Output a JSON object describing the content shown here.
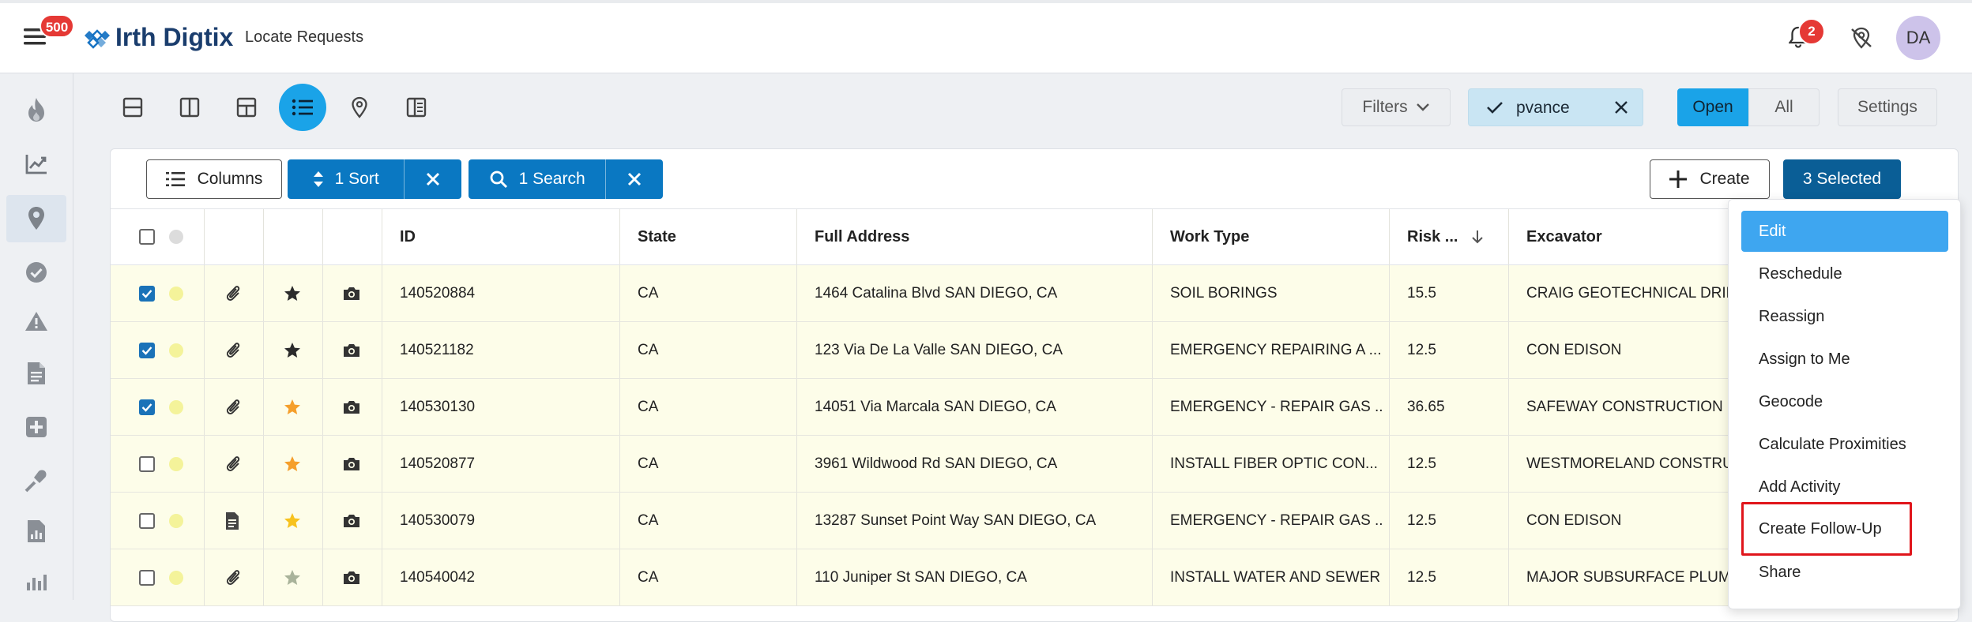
{
  "header": {
    "menu_badge": "500",
    "brand_name": "Irth Digtix",
    "page_title": "Locate Requests",
    "notification_count": "2",
    "user_initials": "DA"
  },
  "toolbar": {
    "filters_label": "Filters",
    "user_filter": "pvance",
    "open_label": "Open",
    "all_label": "All",
    "settings_label": "Settings"
  },
  "grid_toolbar": {
    "columns_label": "Columns",
    "sort_label": "1 Sort",
    "search_label": "1 Search",
    "create_label": "Create",
    "selected_label": "3 Selected"
  },
  "table": {
    "headers": {
      "id": "ID",
      "state": "State",
      "address": "Full Address",
      "work_type": "Work Type",
      "risk": "Risk ...",
      "excavator": "Excavator"
    },
    "rows": [
      {
        "checked": true,
        "attach": "paperclip",
        "star": "black",
        "id": "140520884",
        "state": "CA",
        "address": "1464 Catalina Blvd SAN DIEGO, CA",
        "work_type": "SOIL BORINGS",
        "risk": "15.5",
        "excavator": "CRAIG GEOTECHNICAL DRILL"
      },
      {
        "checked": true,
        "attach": "paperclip",
        "star": "black",
        "id": "140521182",
        "state": "CA",
        "address": "123 Via De La Valle SAN DIEGO, CA",
        "work_type": "EMERGENCY REPAIRING A ...",
        "risk": "12.5",
        "excavator": "CON EDISON"
      },
      {
        "checked": true,
        "attach": "paperclip",
        "star": "orange",
        "id": "140530130",
        "state": "CA",
        "address": "14051 Via Marcala SAN DIEGO, CA",
        "work_type": "EMERGENCY - REPAIR GAS ...",
        "risk": "36.65",
        "excavator": "SAFEWAY CONSTRUCTION"
      },
      {
        "checked": false,
        "attach": "paperclip",
        "star": "orange",
        "id": "140520877",
        "state": "CA",
        "address": "3961 Wildwood Rd SAN DIEGO, CA",
        "work_type": "INSTALL FIBER OPTIC CON...",
        "risk": "12.5",
        "excavator": "WESTMORELAND CONSTRUC"
      },
      {
        "checked": false,
        "attach": "document",
        "star": "yellow",
        "id": "140530079",
        "state": "CA",
        "address": "13287 Sunset Point Way SAN DIEGO, CA",
        "work_type": "EMERGENCY - REPAIR GAS ...",
        "risk": "12.5",
        "excavator": "CON EDISON"
      },
      {
        "checked": false,
        "attach": "paperclip",
        "star": "grey",
        "id": "140540042",
        "state": "CA",
        "address": "110 Juniper St SAN DIEGO, CA",
        "work_type": "INSTALL WATER AND SEWER",
        "risk": "12.5",
        "excavator": "MAJOR SUBSURFACE PLUMB"
      }
    ]
  },
  "context_menu": {
    "items": [
      "Edit",
      "Reschedule",
      "Reassign",
      "Assign to Me",
      "Geocode",
      "Calculate Proximities",
      "Add Activity",
      "Create Follow-Up",
      "Share"
    ],
    "active_item": "Edit",
    "highlighted_item": "Create Follow-Up"
  },
  "colors": {
    "accent": "#1aa3e8",
    "primary_dark": "#0a5e96",
    "row_highlight": "#fdfde9",
    "badge_red": "#e53935",
    "callout_red": "#e0151b",
    "star_orange": "#f59f2b",
    "star_yellow": "#f7c21e",
    "star_grey": "#a9b39a"
  }
}
